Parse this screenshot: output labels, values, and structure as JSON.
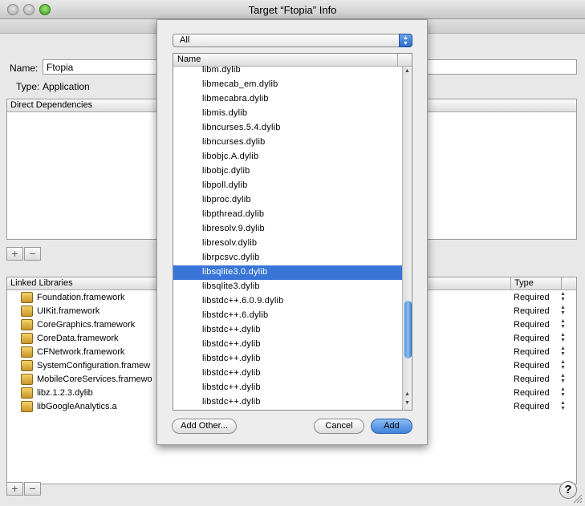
{
  "window": {
    "title": "Target “Ftopia” Info"
  },
  "form": {
    "name_label": "Name:",
    "name_value": "Ftopia",
    "type_label": "Type:",
    "type_value": "Application"
  },
  "direct_dependencies": {
    "header": "Direct Dependencies"
  },
  "linked_libraries": {
    "header": "Linked Libraries",
    "type_header": "Type",
    "rows": [
      {
        "name": "Foundation.framework",
        "type": "Required"
      },
      {
        "name": "UIKit.framework",
        "type": "Required"
      },
      {
        "name": "CoreGraphics.framework",
        "type": "Required"
      },
      {
        "name": "CoreData.framework",
        "type": "Required"
      },
      {
        "name": "CFNetwork.framework",
        "type": "Required"
      },
      {
        "name": "SystemConfiguration.framew",
        "type": "Required"
      },
      {
        "name": "MobileCoreServices.framewo",
        "type": "Required"
      },
      {
        "name": "libz.1.2.3.dylib",
        "type": "Required"
      },
      {
        "name": "libGoogleAnalytics.a",
        "type": "Required"
      }
    ]
  },
  "controls": {
    "plus": "+",
    "minus": "−",
    "help": "?"
  },
  "sheet": {
    "filter_value": "All",
    "list_header": "Name",
    "selected_index": 14,
    "files": [
      "libm.dylib",
      "libmecab_em.dylib",
      "libmecabra.dylib",
      "libmis.dylib",
      "libncurses.5.4.dylib",
      "libncurses.dylib",
      "libobjc.A.dylib",
      "libobjc.dylib",
      "libpoll.dylib",
      "libproc.dylib",
      "libpthread.dylib",
      "libresolv.9.dylib",
      "libresolv.dylib",
      "librpcsvc.dylib",
      "libsqlite3.0.dylib",
      "libsqlite3.dylib",
      "libstdc++.6.0.9.dylib",
      "libstdc++.6.dylib",
      "libstdc++.dylib",
      "libstdc++.dylib",
      "libstdc++.dylib",
      "libstdc++.dylib",
      "libstdc++.dylib",
      "libstdc++.dylib"
    ],
    "add_other_label": "Add Other...",
    "cancel_label": "Cancel",
    "add_label": "Add",
    "accent_color": "#3875d7"
  }
}
